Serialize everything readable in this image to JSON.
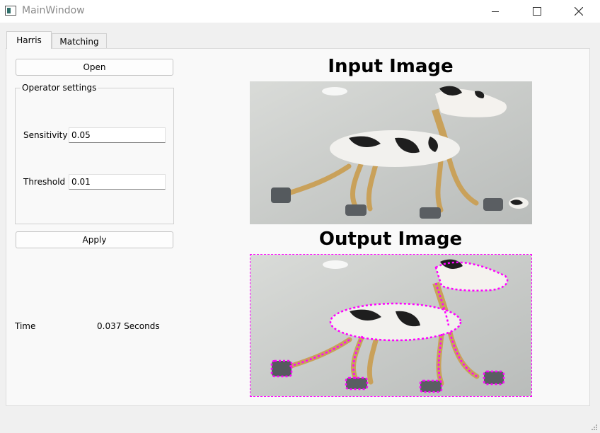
{
  "window": {
    "title": "MainWindow"
  },
  "tabs": [
    {
      "label": "Harris"
    },
    {
      "label": "Matching"
    }
  ],
  "controls": {
    "open_label": "Open",
    "group_title": "Operator settings",
    "sensitivity_label": "Sensitivity",
    "sensitivity_value": "0.05",
    "threshold_label": "Threshold",
    "threshold_value": "0.01",
    "apply_label": "Apply",
    "time_label": "Time",
    "time_value": "0.037 Seconds"
  },
  "images": {
    "input_title": "Input Image",
    "output_title": "Output Image"
  },
  "colors": {
    "corner_marker": "#ff00ff",
    "accent": "#000000"
  }
}
